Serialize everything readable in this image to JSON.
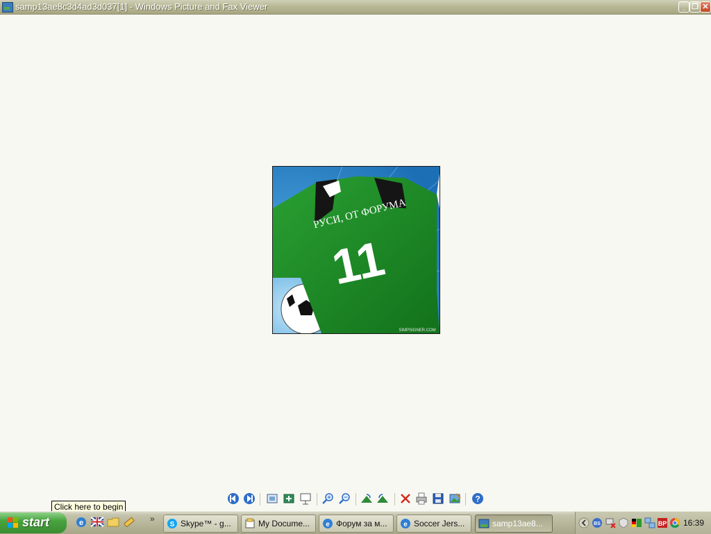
{
  "window": {
    "title": "samp13ae8c3d4ad3d037[1] - Windows Picture and Fax Viewer",
    "buttons": [
      "minimize",
      "restore",
      "close"
    ]
  },
  "image": {
    "shirt_text": "РУСИ, ОТ ФОРУМА",
    "shirt_number": "11",
    "watermark": "SIMPSIGNER.COM",
    "colors": {
      "shirt": "#1e8a26",
      "background": "#2f8fd0",
      "collar": "#151515"
    }
  },
  "toolbar": {
    "buttons": [
      {
        "name": "previous-image-button",
        "icon": "previous-icon"
      },
      {
        "name": "next-image-button",
        "icon": "next-icon"
      },
      {
        "name": "best-fit-button",
        "icon": "best-fit-icon"
      },
      {
        "name": "actual-size-button",
        "icon": "actual-size-icon"
      },
      {
        "name": "slideshow-button",
        "icon": "slideshow-icon"
      },
      {
        "name": "zoom-in-button",
        "icon": "zoom-in-icon"
      },
      {
        "name": "zoom-out-button",
        "icon": "zoom-out-icon"
      },
      {
        "name": "rotate-clockwise-button",
        "icon": "rotate-clockwise-icon"
      },
      {
        "name": "rotate-counterclockwise-button",
        "icon": "rotate-counterclockwise-icon"
      },
      {
        "name": "delete-button",
        "icon": "delete-icon"
      },
      {
        "name": "print-button",
        "icon": "print-icon"
      },
      {
        "name": "save-button",
        "icon": "save-icon"
      },
      {
        "name": "open-for-editing-button",
        "icon": "edit-icon"
      },
      {
        "name": "help-button",
        "icon": "help-icon"
      }
    ]
  },
  "tooltip": {
    "text": "Click here to begin"
  },
  "taskbar": {
    "start_label": "start",
    "quick_launch": [
      "internet-explorer-icon",
      "language-flag-icon",
      "folder-icon",
      "pencil-icon"
    ],
    "more_label": "»",
    "tasks": [
      {
        "label": "Skype™ - g...",
        "icon": "skype-icon",
        "active": false
      },
      {
        "label": "My Docume...",
        "icon": "documents-icon",
        "active": false
      },
      {
        "label": "Форум за м...",
        "icon": "browser-icon",
        "active": false
      },
      {
        "label": "Soccer Jers...",
        "icon": "browser-icon",
        "active": false
      },
      {
        "label": "samp13ae8...",
        "icon": "picture-viewer-icon",
        "active": true
      }
    ],
    "tray_icons": [
      "tray-expand-icon",
      "bs-icon",
      "network-error-icon",
      "shield-icon",
      "german-flag-icon",
      "network-icon",
      "bp-icon",
      "chrome-icon"
    ],
    "tray_bp_label": "BP",
    "tray_bs_label": "BS",
    "clock": "16:39"
  }
}
